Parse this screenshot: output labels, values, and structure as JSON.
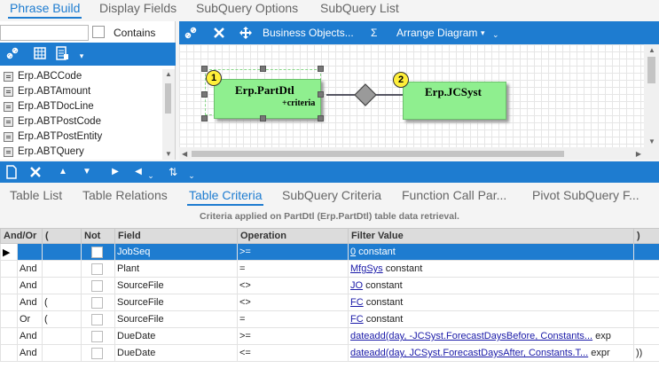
{
  "top_tabs": [
    "Phrase Build",
    "Display Fields",
    "SubQuery Options",
    "SubQuery List"
  ],
  "left_panel": {
    "search_value": "",
    "contains_label": "Contains",
    "fields": [
      "Erp.ABCCode",
      "Erp.ABTAmount",
      "Erp.ABTDocLine",
      "Erp.ABTPostCode",
      "Erp.ABTPostEntity",
      "Erp.ABTQuery"
    ]
  },
  "diagram_toolbar": {
    "business_objects": "Business Objects...",
    "sigma": "Σ",
    "arrange": "Arrange Diagram",
    "arrange_caret": "▾"
  },
  "diagram": {
    "node1": {
      "badge": "1",
      "title": "Erp.PartDtl",
      "subtitle": "+criteria"
    },
    "node2": {
      "badge": "2",
      "title": "Erp.JCSyst"
    }
  },
  "bottom_tabs": [
    "Table List",
    "Table Relations",
    "Table Criteria",
    "SubQuery Criteria",
    "Function Call Par...",
    "Pivot SubQuery F..."
  ],
  "criteria_caption": "Criteria applied on PartDtl (Erp.PartDtl)  table data retrieval.",
  "grid": {
    "columns": [
      "And/Or",
      "(",
      "Not",
      "Field",
      "Operation",
      "Filter Value",
      ")"
    ],
    "rows": [
      {
        "indicator": "▶",
        "andor": "",
        "open": "",
        "field": "JobSeq",
        "op": ">=",
        "link": "0",
        "value": " constant",
        "close": ""
      },
      {
        "indicator": "",
        "andor": "And",
        "open": "",
        "field": "Plant",
        "op": "=",
        "link": "MfgSys",
        "value": " constant",
        "close": ""
      },
      {
        "indicator": "",
        "andor": "And",
        "open": "",
        "field": "SourceFile",
        "op": "<>",
        "link": "JO",
        "value": " constant",
        "close": ""
      },
      {
        "indicator": "",
        "andor": "And",
        "open": "(",
        "field": "SourceFile",
        "op": "<>",
        "link": "FC",
        "value": " constant",
        "close": ""
      },
      {
        "indicator": "",
        "andor": "Or",
        "open": "(",
        "field": "SourceFile",
        "op": "=",
        "link": "FC",
        "value": " constant",
        "close": ""
      },
      {
        "indicator": "",
        "andor": "And",
        "open": "",
        "field": "DueDate",
        "op": ">=",
        "link": "dateadd(day, -JCSyst.ForecastDaysBefore, Constants...",
        "value": " exp",
        "close": ""
      },
      {
        "indicator": "",
        "andor": "And",
        "open": "",
        "field": "DueDate",
        "op": "<=",
        "link": "dateadd(day, JCSyst.ForecastDaysAfter, Constants.T...",
        "value": " expr",
        "close": "))"
      }
    ]
  }
}
